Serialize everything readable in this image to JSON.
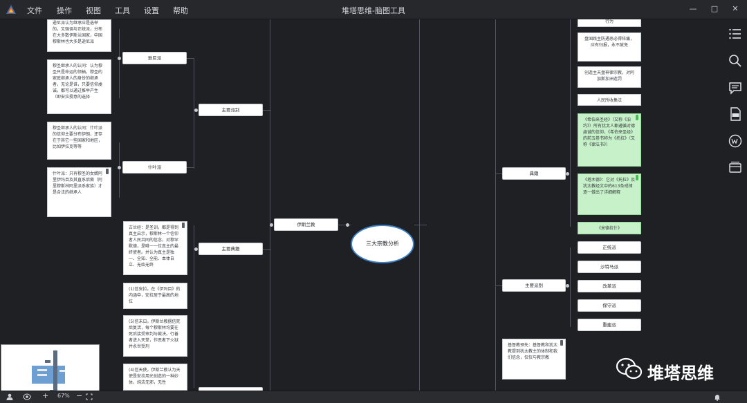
{
  "app": {
    "title": "堆塔思维-脑图工具"
  },
  "menu": [
    "文件",
    "操作",
    "视图",
    "工具",
    "设置",
    "帮助"
  ],
  "window_controls": {
    "min": "—",
    "max": "□",
    "close": "✕"
  },
  "mindmap": {
    "center": "三大宗教分析",
    "left_branch": {
      "label": "伊斯兰教",
      "children": {
        "schools": "主要派别",
        "classics": "主要典籍",
        "sunni": "逊尼派",
        "shia": "什叶派"
      },
      "notes": {
        "sunni_top": "逊尼派认为继承应是选举的，又强调与正统派，分布在大多数伊斯兰国家，中国穆斯林也大多是逊尼派",
        "sunni_succession": "穆圣继承人的认同：认为穆圣只是命运的领袖，穆圣的家庭继承人的身份的继承者，无论是谁，只要信仰虔诚，都可以通过推举产生（即安拉授意的选择",
        "shia_succession": "穆圣继承人的认同：什叶派的信仰主要分布伊朗，还存在于其它一些国家和地区，比如伊拉克等等",
        "shia_doctrine": "什叶派：只有穆圣的女婿阿里伊玛目及其直系后裔（阿里穆斯林阿里派系家族）才是合法的继承人",
        "quran": "古兰经：是圣训，都是得到真主启示，穆斯林一个信仰者人民共同的信念，对穆罕默德，是唯一一位真主的最终使者。并认为真主是独一、全知、全能、本体自立、无始无终",
        "faith1": "(1)信安拉。在《伊玛目》的内涵中，安拉居于最高的地位",
        "faith5": "(5)信末日。伊斯兰教摆信死后复活，每个穆斯林均要在死后接受审判与裁决。行善者进入天堂，作恶者下火狱并永世受刑",
        "faith4": "(4)信天使。伊斯兰教认为天使是安拉用光创造的一种妙体，纯洁无邪，无性"
      }
    },
    "right_branch": {
      "children": {
        "classics": "典籍",
        "schools": "主要派别"
      },
      "notes": {
        "act": "行为",
        "punish": "盘国践主防遇恶必得阵痛，应有归报，永不赦免",
        "create": "创造主天盘神律宗教，对阿加斯加洲造罚",
        "people_write": "人民所收集法",
        "hebrew_bible": "《希伯来圣经》（又称《旧约》）所有犹太人都遵循对德虔诚的信仰，《希伯来圣经》的前五卷书称为《托拉》（又称《律法书》）",
        "talmud": "《塔木德》：它对《托拉》及犹太教经文中的613条戒律逐一做出了详细解释",
        "mishnah": "《米德拉什》",
        "orthodox": "正统派",
        "hasidic": "沙特马派",
        "reform": "改革派",
        "conservative": "保守派",
        "reconstruction": "重建派",
        "sadducee": "基督教预先：基督教和犹太教提到犹太教主的体制和我们信念，仅仅与教宗教"
      }
    }
  },
  "status": {
    "zoom": "67%"
  },
  "watermark": "堆塔思维",
  "colors": {
    "accent": "#3c7fc4",
    "green_note": "#c6f1c9",
    "background": "#1e2024"
  }
}
